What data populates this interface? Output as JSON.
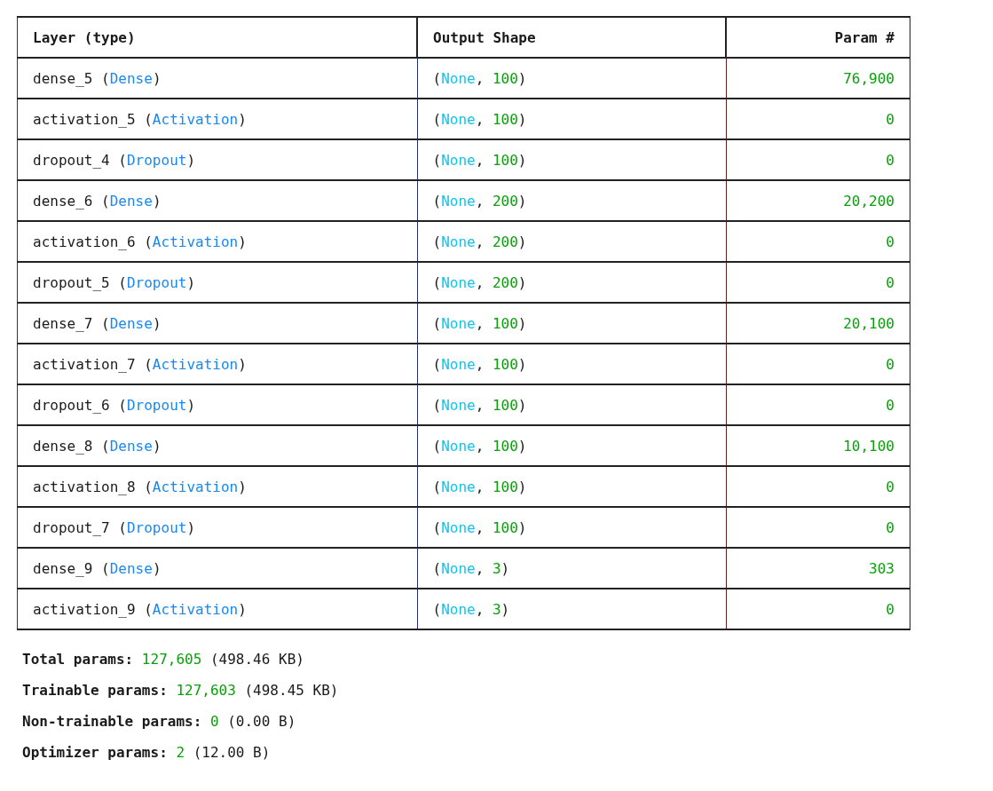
{
  "table": {
    "columns": [
      "Layer (type)",
      "Output Shape",
      "Param #"
    ],
    "rows": [
      {
        "layer": [
          {
            "text": "dense_5 (",
            "kind": "plain"
          },
          {
            "text": "Dense",
            "kind": "type"
          },
          {
            "text": ")",
            "kind": "plain"
          }
        ],
        "output_shape": [
          {
            "text": "(",
            "kind": "plain"
          },
          {
            "text": "None",
            "kind": "none"
          },
          {
            "text": ", ",
            "kind": "plain"
          },
          {
            "text": "100",
            "kind": "number"
          },
          {
            "text": ")",
            "kind": "plain"
          }
        ],
        "params": [
          {
            "text": "76,900",
            "kind": "number"
          }
        ]
      },
      {
        "layer": [
          {
            "text": "activation_5 (",
            "kind": "plain"
          },
          {
            "text": "Activation",
            "kind": "type"
          },
          {
            "text": ")",
            "kind": "plain"
          }
        ],
        "output_shape": [
          {
            "text": "(",
            "kind": "plain"
          },
          {
            "text": "None",
            "kind": "none"
          },
          {
            "text": ", ",
            "kind": "plain"
          },
          {
            "text": "100",
            "kind": "number"
          },
          {
            "text": ")",
            "kind": "plain"
          }
        ],
        "params": [
          {
            "text": "0",
            "kind": "number"
          }
        ]
      },
      {
        "layer": [
          {
            "text": "dropout_4 (",
            "kind": "plain"
          },
          {
            "text": "Dropout",
            "kind": "type"
          },
          {
            "text": ")",
            "kind": "plain"
          }
        ],
        "output_shape": [
          {
            "text": "(",
            "kind": "plain"
          },
          {
            "text": "None",
            "kind": "none"
          },
          {
            "text": ", ",
            "kind": "plain"
          },
          {
            "text": "100",
            "kind": "number"
          },
          {
            "text": ")",
            "kind": "plain"
          }
        ],
        "params": [
          {
            "text": "0",
            "kind": "number"
          }
        ]
      },
      {
        "layer": [
          {
            "text": "dense_6 (",
            "kind": "plain"
          },
          {
            "text": "Dense",
            "kind": "type"
          },
          {
            "text": ")",
            "kind": "plain"
          }
        ],
        "output_shape": [
          {
            "text": "(",
            "kind": "plain"
          },
          {
            "text": "None",
            "kind": "none"
          },
          {
            "text": ", ",
            "kind": "plain"
          },
          {
            "text": "200",
            "kind": "number"
          },
          {
            "text": ")",
            "kind": "plain"
          }
        ],
        "params": [
          {
            "text": "20,200",
            "kind": "number"
          }
        ]
      },
      {
        "layer": [
          {
            "text": "activation_6 (",
            "kind": "plain"
          },
          {
            "text": "Activation",
            "kind": "type"
          },
          {
            "text": ")",
            "kind": "plain"
          }
        ],
        "output_shape": [
          {
            "text": "(",
            "kind": "plain"
          },
          {
            "text": "None",
            "kind": "none"
          },
          {
            "text": ", ",
            "kind": "plain"
          },
          {
            "text": "200",
            "kind": "number"
          },
          {
            "text": ")",
            "kind": "plain"
          }
        ],
        "params": [
          {
            "text": "0",
            "kind": "number"
          }
        ]
      },
      {
        "layer": [
          {
            "text": "dropout_5 (",
            "kind": "plain"
          },
          {
            "text": "Dropout",
            "kind": "type"
          },
          {
            "text": ")",
            "kind": "plain"
          }
        ],
        "output_shape": [
          {
            "text": "(",
            "kind": "plain"
          },
          {
            "text": "None",
            "kind": "none"
          },
          {
            "text": ", ",
            "kind": "plain"
          },
          {
            "text": "200",
            "kind": "number"
          },
          {
            "text": ")",
            "kind": "plain"
          }
        ],
        "params": [
          {
            "text": "0",
            "kind": "number"
          }
        ]
      },
      {
        "layer": [
          {
            "text": "dense_7 (",
            "kind": "plain"
          },
          {
            "text": "Dense",
            "kind": "type"
          },
          {
            "text": ")",
            "kind": "plain"
          }
        ],
        "output_shape": [
          {
            "text": "(",
            "kind": "plain"
          },
          {
            "text": "None",
            "kind": "none"
          },
          {
            "text": ", ",
            "kind": "plain"
          },
          {
            "text": "100",
            "kind": "number"
          },
          {
            "text": ")",
            "kind": "plain"
          }
        ],
        "params": [
          {
            "text": "20,100",
            "kind": "number"
          }
        ]
      },
      {
        "layer": [
          {
            "text": "activation_7 (",
            "kind": "plain"
          },
          {
            "text": "Activation",
            "kind": "type"
          },
          {
            "text": ")",
            "kind": "plain"
          }
        ],
        "output_shape": [
          {
            "text": "(",
            "kind": "plain"
          },
          {
            "text": "None",
            "kind": "none"
          },
          {
            "text": ", ",
            "kind": "plain"
          },
          {
            "text": "100",
            "kind": "number"
          },
          {
            "text": ")",
            "kind": "plain"
          }
        ],
        "params": [
          {
            "text": "0",
            "kind": "number"
          }
        ]
      },
      {
        "layer": [
          {
            "text": "dropout_6 (",
            "kind": "plain"
          },
          {
            "text": "Dropout",
            "kind": "type"
          },
          {
            "text": ")",
            "kind": "plain"
          }
        ],
        "output_shape": [
          {
            "text": "(",
            "kind": "plain"
          },
          {
            "text": "None",
            "kind": "none"
          },
          {
            "text": ", ",
            "kind": "plain"
          },
          {
            "text": "100",
            "kind": "number"
          },
          {
            "text": ")",
            "kind": "plain"
          }
        ],
        "params": [
          {
            "text": "0",
            "kind": "number"
          }
        ]
      },
      {
        "layer": [
          {
            "text": "dense_8 (",
            "kind": "plain"
          },
          {
            "text": "Dense",
            "kind": "type"
          },
          {
            "text": ")",
            "kind": "plain"
          }
        ],
        "output_shape": [
          {
            "text": "(",
            "kind": "plain"
          },
          {
            "text": "None",
            "kind": "none"
          },
          {
            "text": ", ",
            "kind": "plain"
          },
          {
            "text": "100",
            "kind": "number"
          },
          {
            "text": ")",
            "kind": "plain"
          }
        ],
        "params": [
          {
            "text": "10,100",
            "kind": "number"
          }
        ]
      },
      {
        "layer": [
          {
            "text": "activation_8 (",
            "kind": "plain"
          },
          {
            "text": "Activation",
            "kind": "type"
          },
          {
            "text": ")",
            "kind": "plain"
          }
        ],
        "output_shape": [
          {
            "text": "(",
            "kind": "plain"
          },
          {
            "text": "None",
            "kind": "none"
          },
          {
            "text": ", ",
            "kind": "plain"
          },
          {
            "text": "100",
            "kind": "number"
          },
          {
            "text": ")",
            "kind": "plain"
          }
        ],
        "params": [
          {
            "text": "0",
            "kind": "number"
          }
        ]
      },
      {
        "layer": [
          {
            "text": "dropout_7 (",
            "kind": "plain"
          },
          {
            "text": "Dropout",
            "kind": "type"
          },
          {
            "text": ")",
            "kind": "plain"
          }
        ],
        "output_shape": [
          {
            "text": "(",
            "kind": "plain"
          },
          {
            "text": "None",
            "kind": "none"
          },
          {
            "text": ", ",
            "kind": "plain"
          },
          {
            "text": "100",
            "kind": "number"
          },
          {
            "text": ")",
            "kind": "plain"
          }
        ],
        "params": [
          {
            "text": "0",
            "kind": "number"
          }
        ]
      },
      {
        "layer": [
          {
            "text": "dense_9 (",
            "kind": "plain"
          },
          {
            "text": "Dense",
            "kind": "type"
          },
          {
            "text": ")",
            "kind": "plain"
          }
        ],
        "output_shape": [
          {
            "text": "(",
            "kind": "plain"
          },
          {
            "text": "None",
            "kind": "none"
          },
          {
            "text": ", ",
            "kind": "plain"
          },
          {
            "text": "3",
            "kind": "number"
          },
          {
            "text": ")",
            "kind": "plain"
          }
        ],
        "params": [
          {
            "text": "303",
            "kind": "number"
          }
        ]
      },
      {
        "layer": [
          {
            "text": "activation_9 (",
            "kind": "plain"
          },
          {
            "text": "Activation",
            "kind": "type"
          },
          {
            "text": ")",
            "kind": "plain"
          }
        ],
        "output_shape": [
          {
            "text": "(",
            "kind": "plain"
          },
          {
            "text": "None",
            "kind": "none"
          },
          {
            "text": ", ",
            "kind": "plain"
          },
          {
            "text": "3",
            "kind": "number"
          },
          {
            "text": ")",
            "kind": "plain"
          }
        ],
        "params": [
          {
            "text": "0",
            "kind": "number"
          }
        ]
      }
    ]
  },
  "summary": [
    [
      {
        "text": "Total params: ",
        "kind": "label"
      },
      {
        "text": "127,605",
        "kind": "number"
      },
      {
        "text": " (498.46 KB)",
        "kind": "plain"
      }
    ],
    [
      {
        "text": "Trainable params: ",
        "kind": "label"
      },
      {
        "text": "127,603",
        "kind": "number"
      },
      {
        "text": " (498.45 KB)",
        "kind": "plain"
      }
    ],
    [
      {
        "text": "Non-trainable params: ",
        "kind": "label"
      },
      {
        "text": "0",
        "kind": "number"
      },
      {
        "text": " (0.00 B)",
        "kind": "plain"
      }
    ],
    [
      {
        "text": "Optimizer params: ",
        "kind": "label"
      },
      {
        "text": "2",
        "kind": "number"
      },
      {
        "text": " (12.00 B)",
        "kind": "plain"
      }
    ]
  ]
}
